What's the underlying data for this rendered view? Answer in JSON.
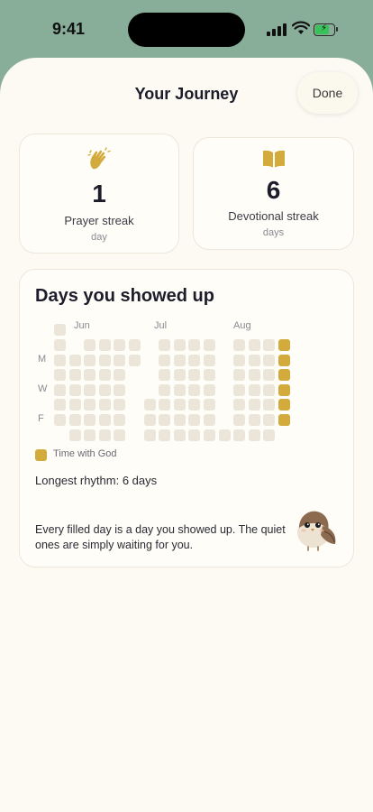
{
  "status": {
    "time": "9:41"
  },
  "header": {
    "title": "Your Journey",
    "done_label": "Done"
  },
  "stats": [
    {
      "icon": "clapping-hands-icon",
      "value": "1",
      "label": "Prayer streak",
      "unit": "day"
    },
    {
      "icon": "open-book-icon",
      "value": "6",
      "label": "Devotional streak",
      "unit": "days"
    }
  ],
  "heatmap": {
    "title": "Days you showed up",
    "months": [
      "Jun",
      "Jul",
      "Aug"
    ],
    "day_labels": [
      "M",
      "W",
      "F"
    ],
    "legend": "Time with God",
    "longest": "Longest rhythm: 6 days",
    "message": "Every filled day is a day you showed up. The quiet ones are simply waiting for you.",
    "accent_color": "#d2ab3c",
    "empty_color": "#ebe6d9",
    "weeks": [
      [
        0,
        0,
        0,
        0,
        0,
        0,
        0
      ],
      [
        null,
        0,
        0,
        0,
        0,
        0,
        0
      ],
      [
        0,
        0,
        0,
        0,
        0,
        0,
        0
      ],
      [
        0,
        0,
        0,
        0,
        0,
        0,
        0
      ],
      [
        0,
        0,
        0,
        0,
        0,
        0,
        0
      ],
      [
        0,
        0,
        null,
        null,
        null,
        null,
        null
      ],
      [
        null,
        null,
        null,
        null,
        0,
        0,
        0
      ],
      [
        0,
        0,
        0,
        0,
        0,
        0,
        0
      ],
      [
        0,
        0,
        0,
        0,
        0,
        0,
        0
      ],
      [
        0,
        0,
        0,
        0,
        0,
        0,
        0
      ],
      [
        0,
        0,
        0,
        0,
        0,
        0,
        0
      ],
      [
        null,
        null,
        null,
        null,
        null,
        null,
        0
      ],
      [
        0,
        0,
        0,
        0,
        0,
        0,
        0
      ],
      [
        0,
        0,
        0,
        0,
        0,
        0,
        0
      ],
      [
        0,
        0,
        0,
        0,
        0,
        0,
        0
      ],
      [
        1,
        1,
        1,
        1,
        1,
        1,
        null
      ]
    ],
    "week_offset": [
      "-1",
      "0",
      "0",
      "0",
      "0",
      "0",
      "0",
      "0",
      "0",
      "0",
      "0",
      "0",
      "0",
      "0",
      "0",
      "0"
    ]
  }
}
